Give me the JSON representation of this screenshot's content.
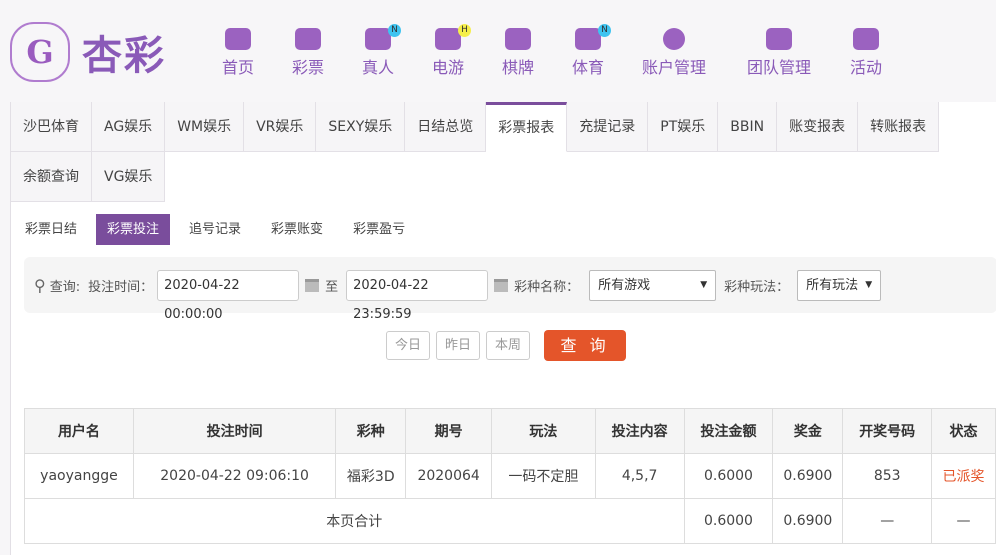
{
  "brand": {
    "name": "杏彩",
    "logo_letter": "G"
  },
  "nav": [
    {
      "label": "首页",
      "icon": "home-icon"
    },
    {
      "label": "彩票",
      "icon": "ticket-icon"
    },
    {
      "label": "真人",
      "icon": "live-dealer-icon",
      "badge": "N"
    },
    {
      "label": "电游",
      "icon": "gamepad-icon",
      "badge": "H"
    },
    {
      "label": "棋牌",
      "icon": "cards-icon"
    },
    {
      "label": "体育",
      "icon": "trophy-icon",
      "badge": "N"
    },
    {
      "label": "账户管理",
      "icon": "yen-icon"
    },
    {
      "label": "团队管理",
      "icon": "team-icon"
    },
    {
      "label": "活动",
      "icon": "gift-icon"
    }
  ],
  "tabs_row1": [
    "沙巴体育",
    "AG娱乐",
    "WM娱乐",
    "VR娱乐",
    "SEXY娱乐",
    "日结总览",
    "彩票报表",
    "充提记录",
    "PT娱乐",
    "BBIN",
    "账变报表",
    "转账报表"
  ],
  "tabs_row2": [
    "余额查询",
    "VG娱乐"
  ],
  "subtabs": [
    "彩票日结",
    "彩票投注",
    "追号记录",
    "彩票账变",
    "彩票盈亏"
  ],
  "filter": {
    "query_label": "查询:",
    "time_label": "投注时间：",
    "start": "2020-04-22 00:00:00",
    "to": "至",
    "end": "2020-04-22 23:59:59",
    "game_label": "彩种名称：",
    "game_value": "所有游戏",
    "play_label": "彩种玩法：",
    "play_value": "所有玩法"
  },
  "quick": [
    "今日",
    "昨日",
    "本周"
  ],
  "search_btn": "查 询",
  "table": {
    "headers": [
      "用户名",
      "投注时间",
      "彩种",
      "期号",
      "玩法",
      "投注内容",
      "投注金额",
      "奖金",
      "开奖号码",
      "状态"
    ],
    "rows": [
      [
        "yaoyangge",
        "2020-04-22 09:06:10",
        "福彩3D",
        "2020064",
        "一码不定胆",
        "4,5,7",
        "0.6000",
        "0.6900",
        "853",
        "已派奖"
      ]
    ],
    "total": {
      "label": "本页合计",
      "amount": "0.6000",
      "bonus": "0.6900",
      "number": "—",
      "status": "—"
    }
  },
  "colors": {
    "accent": "#7a4d9c",
    "button": "#e4552a"
  }
}
